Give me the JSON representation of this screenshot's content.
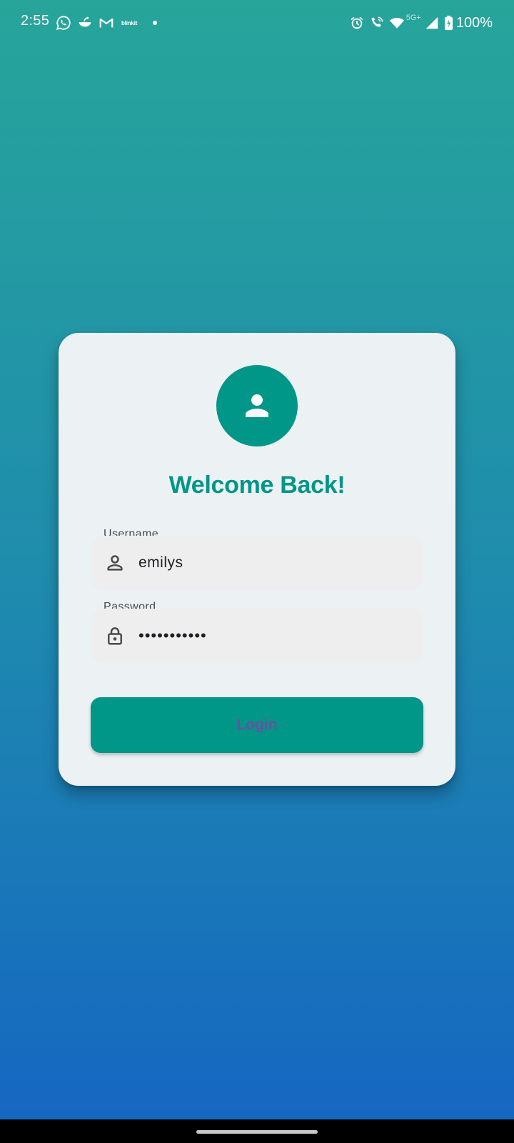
{
  "status_bar": {
    "time": "2:55",
    "left_icons": [
      "whatsapp-icon",
      "swiggy-icon",
      "gmail-icon",
      "blinkit-icon"
    ],
    "blinkit_label": "blinkit",
    "network_type": "5G+",
    "battery": "100%"
  },
  "login_card": {
    "title": "Welcome Back!",
    "username": {
      "label": "Username",
      "value": "emilys",
      "icon": "person-outline-icon"
    },
    "password": {
      "label": "Password",
      "value": "•••••••••••",
      "icon": "lock-icon"
    },
    "login_button": "Login"
  },
  "colors": {
    "primary": "#009688",
    "card_background": "#ecf1f4",
    "field_background": "#eeeeee",
    "gradient_top": "#27a59a",
    "gradient_bottom": "#1565c2",
    "button_text": "#6c4fa0"
  }
}
